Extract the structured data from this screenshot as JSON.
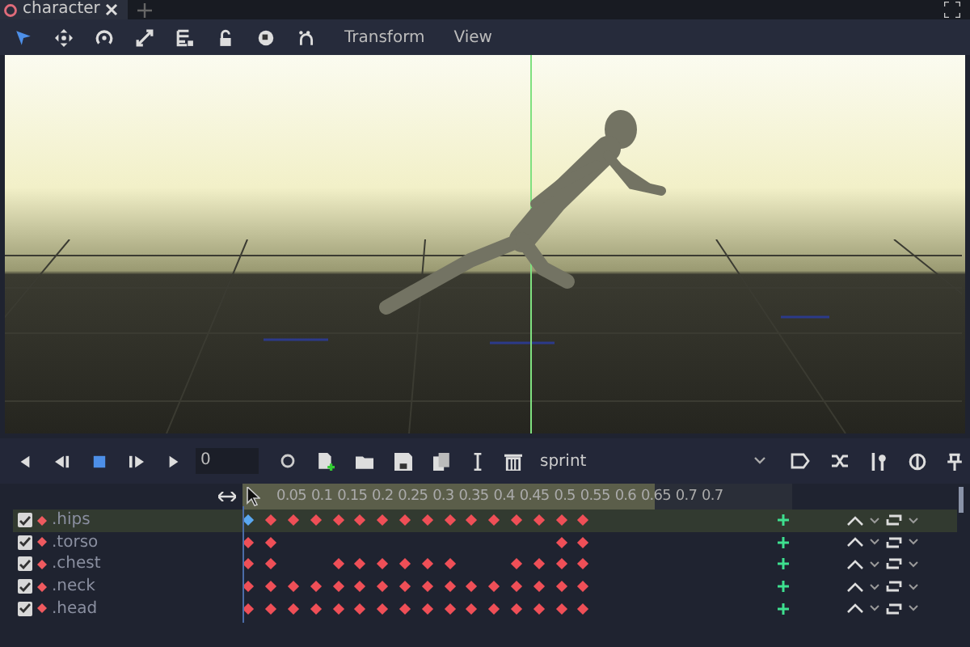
{
  "tabs": [
    {
      "label": "character",
      "selected": true
    }
  ],
  "toolbar": {
    "menus": [
      "Transform",
      "View"
    ]
  },
  "animation": {
    "frame": "0",
    "name": "sprint",
    "ticks": [
      "0.05",
      "0.1",
      "0.15",
      "0.2",
      "0.25",
      "0.3",
      "0.35",
      "0.4",
      "0.45",
      "0.5",
      "0.55",
      "0.6",
      "0.65",
      "0.7",
      "0.7"
    ]
  },
  "tracks": [
    {
      "name": ".hips",
      "selected": true,
      "enabled": true,
      "keys": [
        {
          "on": true,
          "selected": true
        },
        {
          "on": true,
          "selected": false
        },
        {
          "on": true,
          "selected": false
        },
        {
          "on": true,
          "selected": false
        },
        {
          "on": true,
          "selected": false
        },
        {
          "on": true,
          "selected": false
        },
        {
          "on": true,
          "selected": false
        },
        {
          "on": true,
          "selected": false
        },
        {
          "on": true,
          "selected": false
        },
        {
          "on": true,
          "selected": false
        },
        {
          "on": true,
          "selected": false
        },
        {
          "on": true,
          "selected": false
        },
        {
          "on": true,
          "selected": false
        },
        {
          "on": true,
          "selected": false
        },
        {
          "on": true,
          "selected": false
        },
        {
          "on": true,
          "selected": false
        }
      ]
    },
    {
      "name": ".torso",
      "selected": false,
      "enabled": true,
      "keys": [
        {
          "on": true,
          "selected": false
        },
        {
          "on": true,
          "selected": false
        },
        {
          "on": false,
          "selected": false
        },
        {
          "on": false,
          "selected": false
        },
        {
          "on": false,
          "selected": false
        },
        {
          "on": false,
          "selected": false
        },
        {
          "on": false,
          "selected": false
        },
        {
          "on": false,
          "selected": false
        },
        {
          "on": false,
          "selected": false
        },
        {
          "on": false,
          "selected": false
        },
        {
          "on": false,
          "selected": false
        },
        {
          "on": false,
          "selected": false
        },
        {
          "on": false,
          "selected": false
        },
        {
          "on": false,
          "selected": false
        },
        {
          "on": true,
          "selected": false
        },
        {
          "on": true,
          "selected": false
        }
      ]
    },
    {
      "name": ".chest",
      "selected": false,
      "enabled": true,
      "keys": [
        {
          "on": true,
          "selected": false
        },
        {
          "on": true,
          "selected": false
        },
        {
          "on": false,
          "selected": false
        },
        {
          "on": false,
          "selected": false
        },
        {
          "on": true,
          "selected": false
        },
        {
          "on": true,
          "selected": false
        },
        {
          "on": true,
          "selected": false
        },
        {
          "on": true,
          "selected": false
        },
        {
          "on": true,
          "selected": false
        },
        {
          "on": true,
          "selected": false
        },
        {
          "on": false,
          "selected": false
        },
        {
          "on": false,
          "selected": false
        },
        {
          "on": true,
          "selected": false
        },
        {
          "on": true,
          "selected": false
        },
        {
          "on": true,
          "selected": false
        },
        {
          "on": true,
          "selected": false
        }
      ]
    },
    {
      "name": ".neck",
      "selected": false,
      "enabled": true,
      "keys": [
        {
          "on": true,
          "selected": false
        },
        {
          "on": true,
          "selected": false
        },
        {
          "on": true,
          "selected": false
        },
        {
          "on": true,
          "selected": false
        },
        {
          "on": true,
          "selected": false
        },
        {
          "on": true,
          "selected": false
        },
        {
          "on": true,
          "selected": false
        },
        {
          "on": true,
          "selected": false
        },
        {
          "on": true,
          "selected": false
        },
        {
          "on": true,
          "selected": false
        },
        {
          "on": true,
          "selected": false
        },
        {
          "on": true,
          "selected": false
        },
        {
          "on": true,
          "selected": false
        },
        {
          "on": true,
          "selected": false
        },
        {
          "on": true,
          "selected": false
        },
        {
          "on": true,
          "selected": false
        }
      ]
    },
    {
      "name": ".head",
      "selected": false,
      "enabled": true,
      "keys": [
        {
          "on": true,
          "selected": false
        },
        {
          "on": true,
          "selected": false
        },
        {
          "on": true,
          "selected": false
        },
        {
          "on": true,
          "selected": false
        },
        {
          "on": true,
          "selected": false
        },
        {
          "on": true,
          "selected": false
        },
        {
          "on": true,
          "selected": false
        },
        {
          "on": true,
          "selected": false
        },
        {
          "on": true,
          "selected": false
        },
        {
          "on": true,
          "selected": false
        },
        {
          "on": true,
          "selected": false
        },
        {
          "on": true,
          "selected": false
        },
        {
          "on": true,
          "selected": false
        },
        {
          "on": true,
          "selected": false
        },
        {
          "on": true,
          "selected": false
        },
        {
          "on": true,
          "selected": false
        }
      ]
    }
  ]
}
